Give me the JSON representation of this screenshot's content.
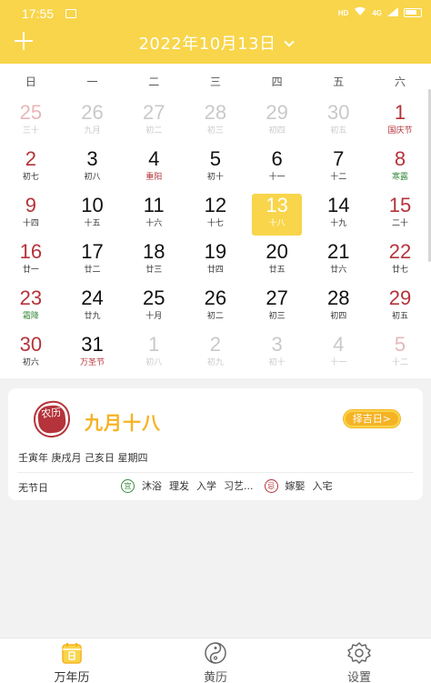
{
  "status_bar": {
    "time": "17:55",
    "network": "HD",
    "signal": "4G"
  },
  "header": {
    "date_title": "2022年10月13日"
  },
  "weekdays": [
    "日",
    "一",
    "二",
    "三",
    "四",
    "五",
    "六"
  ],
  "weeks": [
    [
      {
        "num": "25",
        "lunar": "三十",
        "other": true,
        "weekend": true
      },
      {
        "num": "26",
        "lunar": "九月",
        "other": true
      },
      {
        "num": "27",
        "lunar": "初二",
        "other": true
      },
      {
        "num": "28",
        "lunar": "初三",
        "other": true
      },
      {
        "num": "29",
        "lunar": "初四",
        "other": true
      },
      {
        "num": "30",
        "lunar": "初五",
        "other": true
      },
      {
        "num": "1",
        "lunar": "国庆节",
        "weekend": true,
        "fest": "red"
      }
    ],
    [
      {
        "num": "2",
        "lunar": "初七",
        "weekend": true
      },
      {
        "num": "3",
        "lunar": "初八"
      },
      {
        "num": "4",
        "lunar": "重阳",
        "fest": "red"
      },
      {
        "num": "5",
        "lunar": "初十"
      },
      {
        "num": "6",
        "lunar": "十一"
      },
      {
        "num": "7",
        "lunar": "十二"
      },
      {
        "num": "8",
        "lunar": "寒露",
        "weekend": true,
        "fest": "green"
      }
    ],
    [
      {
        "num": "9",
        "lunar": "十四",
        "weekend": true
      },
      {
        "num": "10",
        "lunar": "十五"
      },
      {
        "num": "11",
        "lunar": "十六"
      },
      {
        "num": "12",
        "lunar": "十七"
      },
      {
        "num": "13",
        "lunar": "十八",
        "selected": true
      },
      {
        "num": "14",
        "lunar": "十九"
      },
      {
        "num": "15",
        "lunar": "二十",
        "weekend": true
      }
    ],
    [
      {
        "num": "16",
        "lunar": "廿一",
        "weekend": true
      },
      {
        "num": "17",
        "lunar": "廿二"
      },
      {
        "num": "18",
        "lunar": "廿三"
      },
      {
        "num": "19",
        "lunar": "廿四"
      },
      {
        "num": "20",
        "lunar": "廿五"
      },
      {
        "num": "21",
        "lunar": "廿六"
      },
      {
        "num": "22",
        "lunar": "廿七",
        "weekend": true
      }
    ],
    [
      {
        "num": "23",
        "lunar": "霜降",
        "weekend": true,
        "fest": "green"
      },
      {
        "num": "24",
        "lunar": "廿九"
      },
      {
        "num": "25",
        "lunar": "十月"
      },
      {
        "num": "26",
        "lunar": "初二"
      },
      {
        "num": "27",
        "lunar": "初三"
      },
      {
        "num": "28",
        "lunar": "初四"
      },
      {
        "num": "29",
        "lunar": "初五",
        "weekend": true
      }
    ],
    [
      {
        "num": "30",
        "lunar": "初六",
        "weekend": true
      },
      {
        "num": "31",
        "lunar": "万圣节",
        "fest": "red"
      },
      {
        "num": "1",
        "lunar": "初八",
        "other": true
      },
      {
        "num": "2",
        "lunar": "初九",
        "other": true
      },
      {
        "num": "3",
        "lunar": "初十",
        "other": true
      },
      {
        "num": "4",
        "lunar": "十一",
        "other": true
      },
      {
        "num": "5",
        "lunar": "十二",
        "other": true,
        "weekend": true
      }
    ]
  ],
  "info_card": {
    "seal_text": "农历",
    "lunar_date": "九月十八",
    "jiri_button": "择吉日>",
    "ganzhi": "壬寅年 庚戌月 己亥日 星期四",
    "festival": "无节日",
    "yi_badge": "宜",
    "yi_items": [
      "沐浴",
      "理发",
      "入学",
      "习艺..."
    ],
    "ji_badge": "忌",
    "ji_items": [
      "嫁娶",
      "入宅"
    ]
  },
  "bottom_nav": [
    {
      "label": "万年历",
      "icon": "calendar-icon",
      "active": true
    },
    {
      "label": "黄历",
      "icon": "yin-yang-icon"
    },
    {
      "label": "设置",
      "icon": "gear-icon"
    }
  ],
  "colors": {
    "accent": "#f8d54a",
    "accent_text": "#f5b324",
    "weekend_red": "#b5333a",
    "solar_term_green": "#3a8a3e"
  }
}
